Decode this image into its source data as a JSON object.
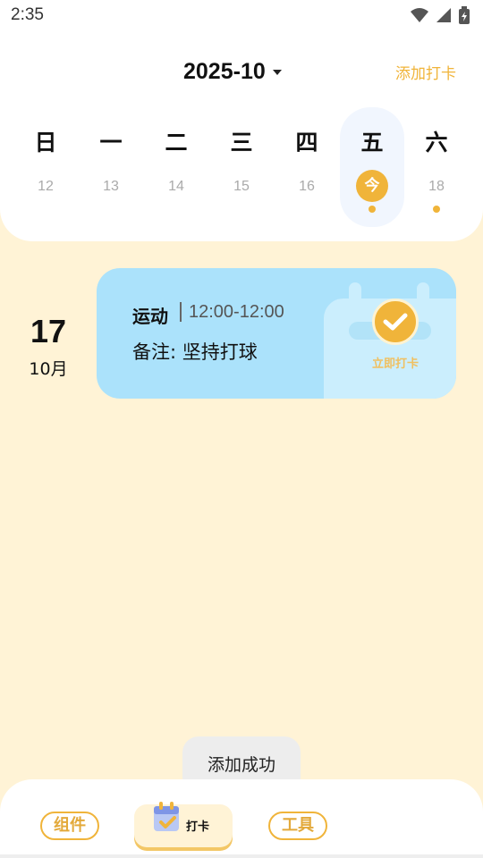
{
  "status_bar": {
    "time": "2:35",
    "icons": [
      "wifi-icon",
      "signal-icon",
      "battery-icon"
    ]
  },
  "header": {
    "month": "2025-10",
    "add_checkin": "添加打卡"
  },
  "week": {
    "days": [
      {
        "weekday": "日",
        "date": "12",
        "today": false,
        "has_event": false
      },
      {
        "weekday": "一",
        "date": "13",
        "today": false,
        "has_event": false
      },
      {
        "weekday": "二",
        "date": "14",
        "today": false,
        "has_event": false
      },
      {
        "weekday": "三",
        "date": "15",
        "today": false,
        "has_event": false
      },
      {
        "weekday": "四",
        "date": "16",
        "today": false,
        "has_event": false
      },
      {
        "weekday": "五",
        "date": "今",
        "today": true,
        "has_event": true
      },
      {
        "weekday": "六",
        "date": "18",
        "today": false,
        "has_event": true
      }
    ]
  },
  "entry": {
    "day": "17",
    "month": "10月",
    "title": "运动",
    "time": "12:00-12:00",
    "note": "备注: 坚持打球",
    "checkin_label": "立即打卡"
  },
  "toast": "添加成功",
  "tab_bar": {
    "left": "组件",
    "center": "打卡",
    "right": "工具"
  },
  "colors": {
    "accent": "#F0B43A",
    "background": "#FFF3D6",
    "card": "#ABE2FB"
  }
}
